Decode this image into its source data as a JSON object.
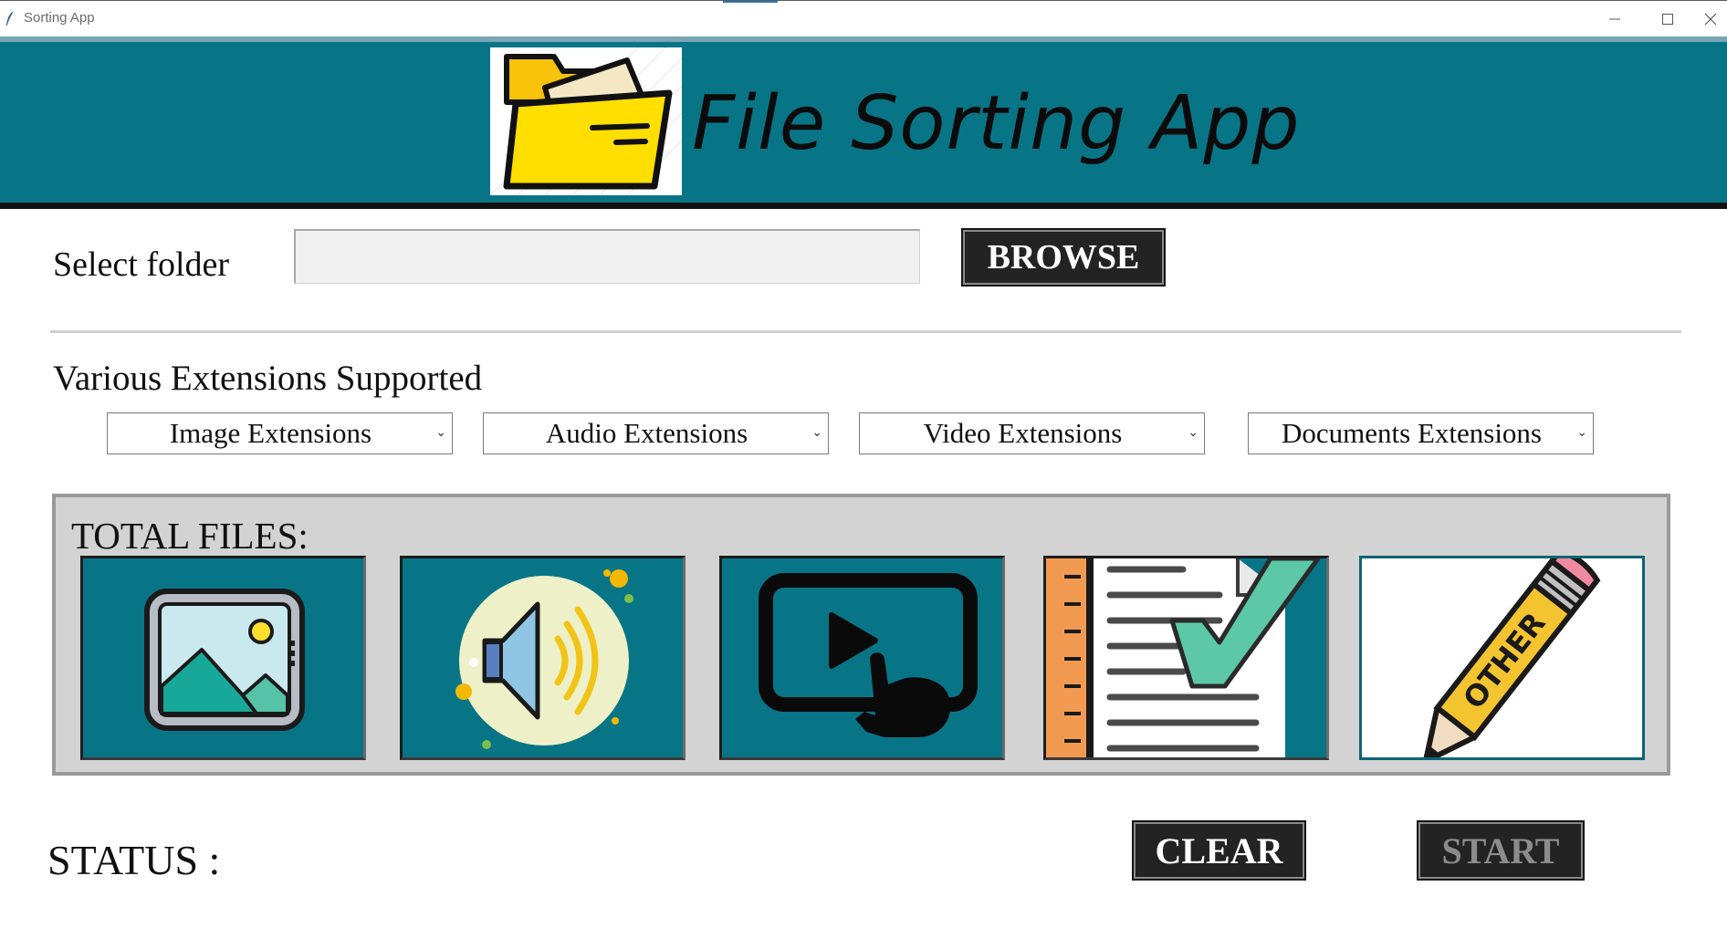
{
  "window": {
    "title": "Sorting App",
    "icon": "feather-icon",
    "controls": [
      "minimize-icon",
      "maximize-icon",
      "close-icon"
    ]
  },
  "header": {
    "logo_icon": "folder-icon",
    "title": "File Sorting App",
    "background": "#087587"
  },
  "folder": {
    "label": "Select folder",
    "value": "",
    "browse_label": "BROWSE"
  },
  "extensions": {
    "heading": "Various Extensions Supported",
    "dropdowns": [
      {
        "label": "Image Extensions"
      },
      {
        "label": "Audio Extensions"
      },
      {
        "label": "Video Extensions"
      },
      {
        "label": "Documents Extensions"
      }
    ]
  },
  "files": {
    "heading": "TOTAL FILES:",
    "tiles": [
      {
        "icon": "image-icon"
      },
      {
        "icon": "audio-speaker-icon"
      },
      {
        "icon": "video-play-icon"
      },
      {
        "icon": "document-check-icon"
      },
      {
        "icon": "other-pencil-icon",
        "text": "OTHER"
      }
    ]
  },
  "status": {
    "label": "STATUS :",
    "value": ""
  },
  "actions": {
    "clear_label": "CLEAR",
    "start_label": "START",
    "start_enabled": false
  }
}
